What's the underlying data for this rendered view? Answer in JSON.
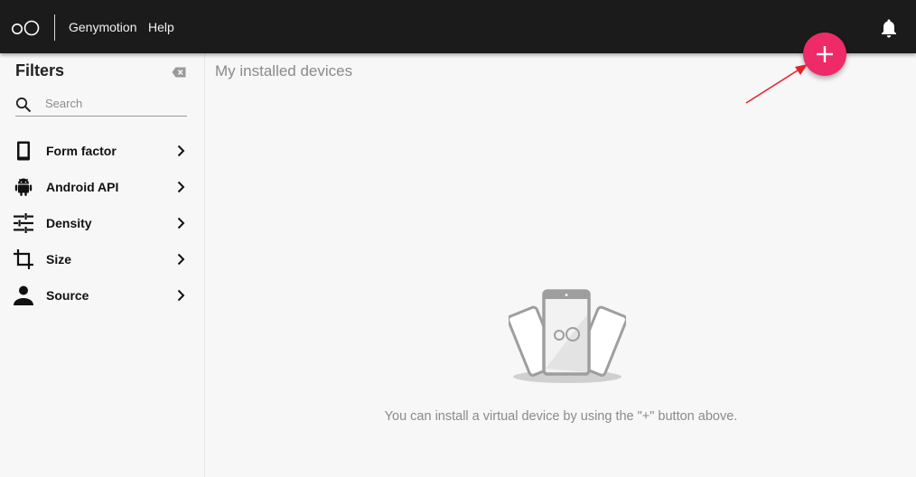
{
  "topbar": {
    "logo_text": "oO",
    "menu": [
      "Genymotion",
      "Help"
    ],
    "icons": [
      "logo-icon",
      "bell-icon"
    ]
  },
  "sidebar": {
    "title": "Filters",
    "search_placeholder": "Search",
    "search_value": "",
    "items": [
      {
        "label": "Form factor",
        "icon": "phone-icon"
      },
      {
        "label": "Android API",
        "icon": "android-icon"
      },
      {
        "label": "Density",
        "icon": "sliders-icon"
      },
      {
        "label": "Size",
        "icon": "crop-icon"
      },
      {
        "label": "Source",
        "icon": "person-icon"
      }
    ]
  },
  "main": {
    "title": "My installed devices",
    "empty_message": "You can install a virtual device by using the \"+\" button above.",
    "illustration_text": "oO"
  },
  "fab": {
    "label": "+",
    "color": "#ee2a68"
  },
  "colors": {
    "topbar": "#1b1b1b",
    "accent": "#ee2a68",
    "annotation": "#e8212b"
  }
}
